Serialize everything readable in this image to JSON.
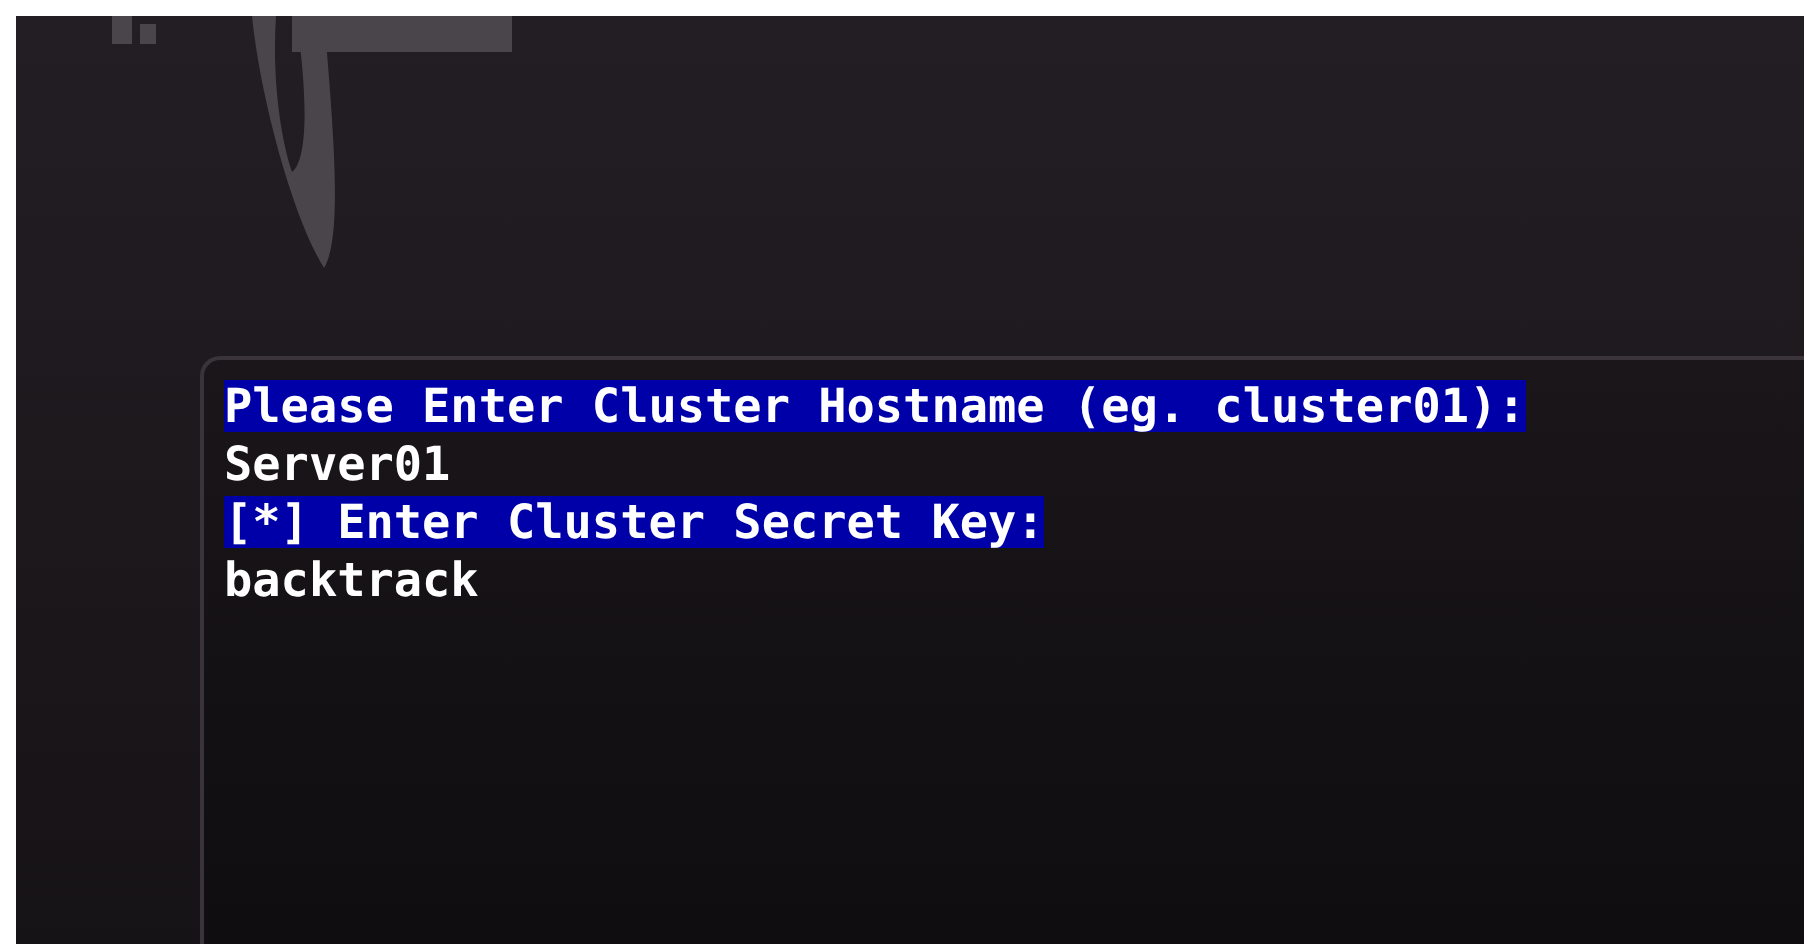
{
  "terminal": {
    "lines": [
      {
        "kind": "prompt",
        "text": "Please Enter Cluster Hostname (eg. cluster01):"
      },
      {
        "kind": "input",
        "text": "Server01"
      },
      {
        "kind": "prompt",
        "text": "[*] Enter Cluster Secret Key:"
      },
      {
        "kind": "input",
        "text": "backtrack"
      }
    ]
  }
}
